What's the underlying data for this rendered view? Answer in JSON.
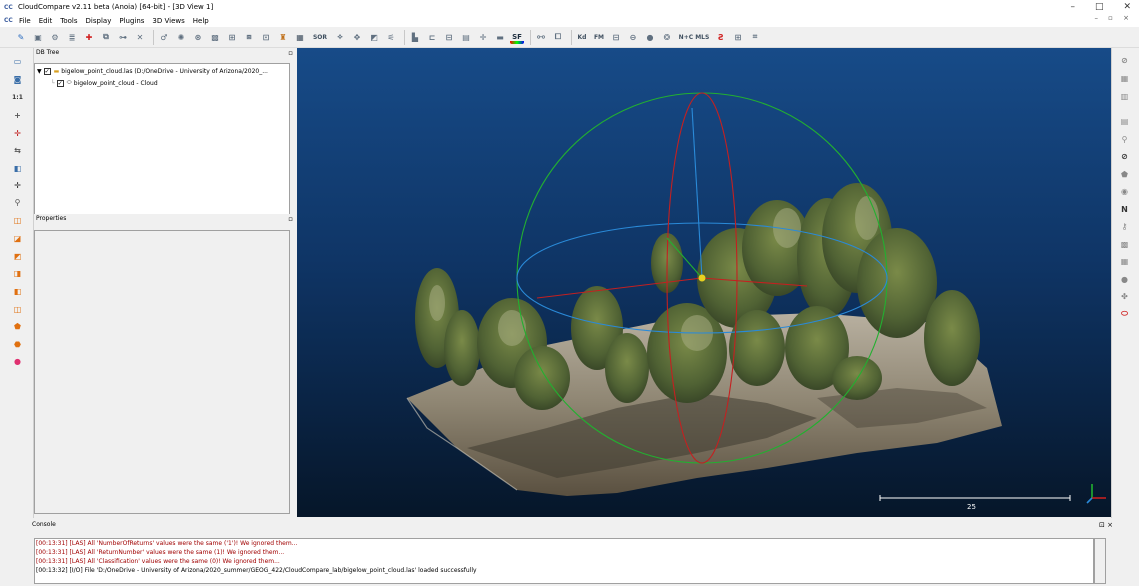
{
  "window": {
    "title": "CloudCompare v2.11 beta (Anoia) [64-bit] - [3D View 1]",
    "app_icon": "CC",
    "controls": [
      "–",
      "□",
      "✕"
    ]
  },
  "menubar": {
    "app_icon": "CC",
    "items": [
      "File",
      "Edit",
      "Tools",
      "Display",
      "Plugins",
      "3D Views",
      "Help"
    ],
    "mdi_controls": "– ▫ ×"
  },
  "toolbar": {
    "sor_label": "SOR",
    "sf_label": "SF",
    "fm_label": "FM",
    "kd_label": "Kd",
    "ncmls_label": "N+C MLS",
    "icons": [
      "pencil-icon",
      "save-icon",
      "settings-icon",
      "list-icon",
      "add-point-icon",
      "merge-icon",
      "segment-icon",
      "delete-icon",
      "normal-icon",
      "sample-icon",
      "fit-icon",
      "scalar-icon",
      "subsample-icon",
      "bbox-icon",
      "cc-icon",
      "sf-brush-icon",
      "sor-icon",
      "crop-icon",
      "compass-icon",
      "plane-icon",
      "expand-icon",
      "histogram-icon",
      "gradient-icon",
      "filter-icon",
      "add-sf-icon",
      "remove-sf-icon",
      "sf-color-icon",
      "sf-gradient-icon",
      "compare-icon",
      "kd-icon",
      "fm-icon",
      "disk-icon",
      "hole-icon",
      "sphere-icon",
      "ransac-icon",
      "ncmls-icon",
      "m3c2-icon",
      "octree-icon",
      "transform-icon"
    ]
  },
  "dbtree": {
    "header": "DB Tree",
    "file_item": "bigelow_point_cloud.las (D:/OneDrive - University of Arizona/2020_...",
    "cloud_item": "bigelow_point_cloud - Cloud"
  },
  "properties": {
    "header": "Properties"
  },
  "view": {
    "scale_label": "25",
    "accent_red": "#c42020",
    "accent_green": "#22b030",
    "accent_blue": "#2a8ad8"
  },
  "console": {
    "header": "Console",
    "controls": "⊡ ×",
    "lines": [
      {
        "text": "[00:13:31] [LAS] All 'NumberOfReturns' values were the same ('1')! We ignored them...",
        "color": "#a00000"
      },
      {
        "text": "[00:13:31] [LAS] All 'ReturnNumber' values were the same (1)! We ignored them...",
        "color": "#a00000"
      },
      {
        "text": "[00:13:31] [LAS] All 'Classification' values were the same (0)! We ignored them...",
        "color": "#a00000"
      },
      {
        "text": "[00:13:32] [I/O] File 'D:/OneDrive - University of Arizona/2020_summer/GEOG_422/CloudCompare_lab/bigelow_point_cloud.las' loaded successfully",
        "color": "#000000"
      }
    ]
  }
}
